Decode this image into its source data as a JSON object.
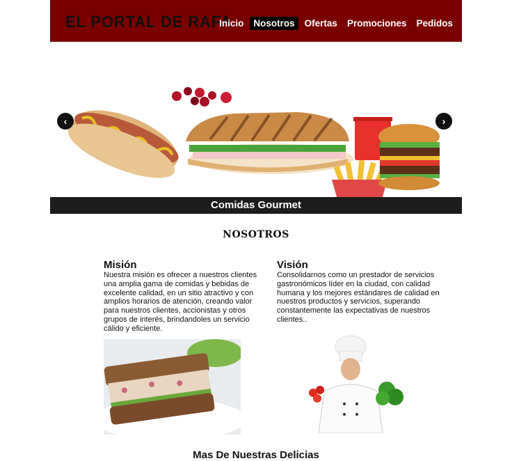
{
  "header": {
    "logo": "EL PORTAL DE RAFA",
    "nav": [
      {
        "label": "Inicio",
        "active": false
      },
      {
        "label": "Nosotros",
        "active": true
      },
      {
        "label": "Ofertas",
        "active": false
      },
      {
        "label": "Promociones",
        "active": false
      },
      {
        "label": "Pedidos",
        "active": false
      }
    ]
  },
  "slider": {
    "caption": "Comidas Gourmet",
    "prev_icon": "‹",
    "next_icon": "›"
  },
  "section": {
    "title": "NOSOTROS"
  },
  "mision": {
    "title": "Misión",
    "text": "Nuestra misión es ofrecer a nuestros clientes una amplia gama de comidas y bebidas de excelente calidad, en un sitio atractivo y con amplios horarios de atención, creando valor para nuestros clientes, accionistas y otros grupos de interés, brindandoles un servicio cálido y eficiente."
  },
  "vision": {
    "title": "Visión",
    "text": "Consolidarnos como un prestador de servicios gastronómicos líder en la ciudad, con calidad humana y los mejores estándares de calidad en nuestros productos y servicios, superando constantemente las expectativas de nuestros clientes.."
  },
  "footer": {
    "title": "Mas De Nuestras Delicias"
  },
  "colors": {
    "header_bg": "#7a0000",
    "nav_active_bg": "#000000",
    "caption_bg": "#1c1c1c"
  }
}
